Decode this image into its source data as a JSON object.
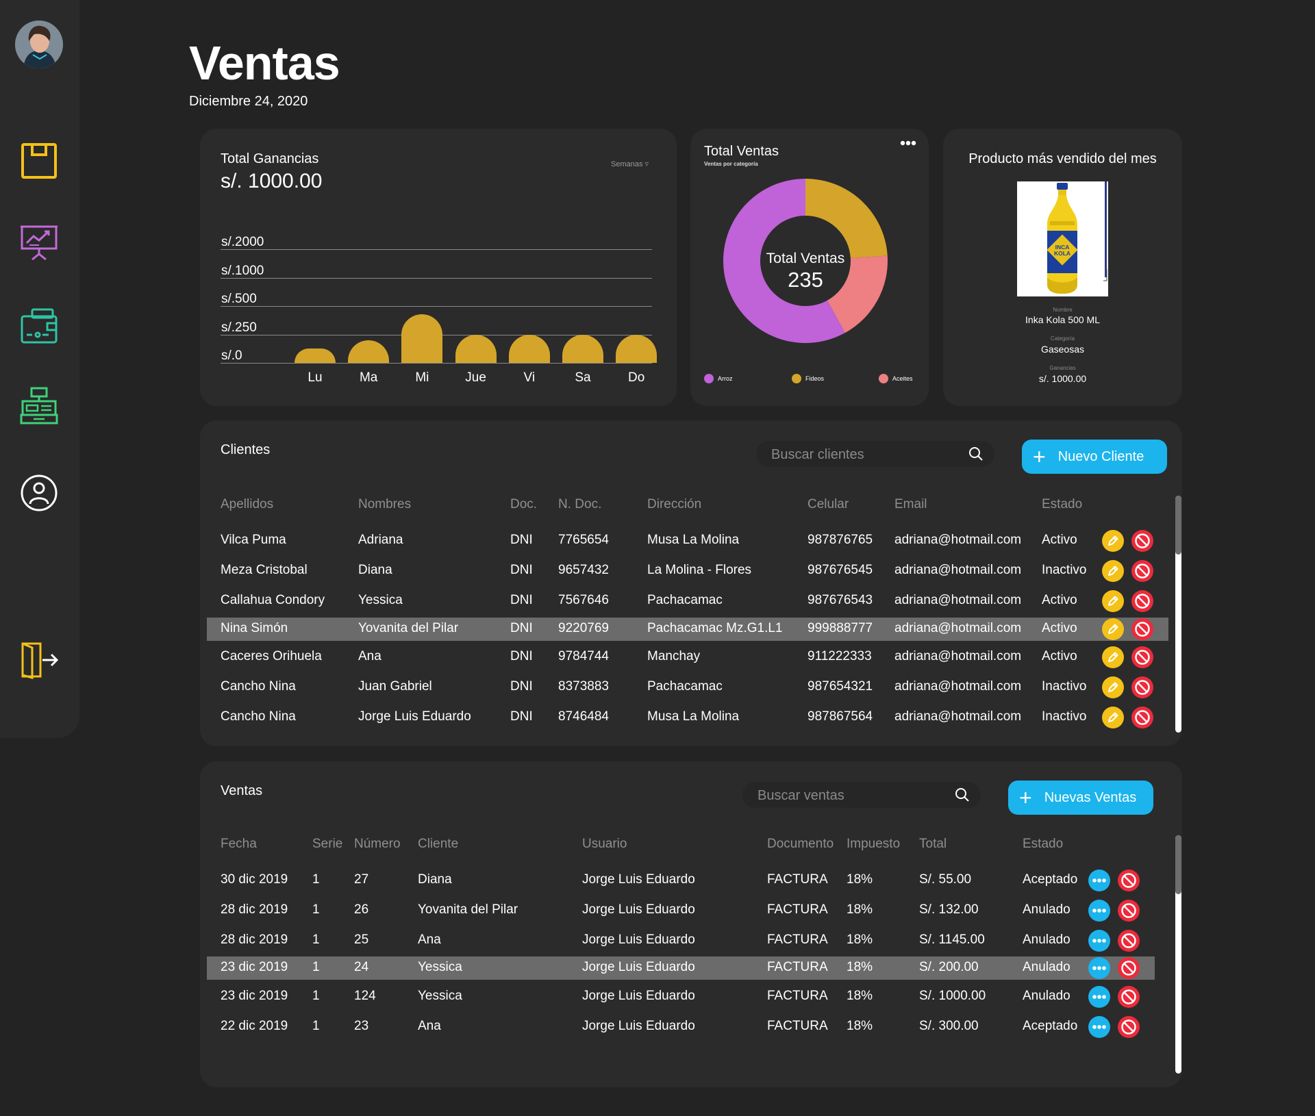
{
  "page": {
    "title": "Ventas",
    "date": "Diciembre 24, 2020"
  },
  "colors": {
    "background": "#232323",
    "card": "#2b2b2b",
    "gold": "#d4a52a",
    "purple": "#c062d8",
    "pink": "#ee7f82",
    "blue": "#1bb4ec",
    "red": "#ec2b3c",
    "yellow": "#f4c119",
    "teal": "#2ec4a6",
    "green": "#3fd27a"
  },
  "sidebar": {
    "icons": [
      "floppy-icon",
      "presentation-chart-icon",
      "wallet-icon",
      "cash-register-icon",
      "user-circle-icon",
      "logout-door-icon"
    ]
  },
  "ganancias": {
    "title": "Total Ganancias",
    "amount": "s/. 1000.00",
    "filter": "Semanas ▿"
  },
  "chart_data": [
    {
      "type": "bar",
      "title": "Total Ganancias",
      "categories": [
        "Lu",
        "Ma",
        "Mi",
        "Jue",
        "Vi",
        "Sa",
        "Do"
      ],
      "values": [
        0.5,
        0.8,
        1.7,
        1.0,
        1.0,
        1.0,
        1.0
      ],
      "ytick_labels": [
        "s/.2000",
        "s/.1000",
        "s/.500",
        "s/.250",
        "s/.0"
      ],
      "ylim": [
        0,
        4
      ],
      "grid": true
    },
    {
      "type": "pie",
      "title": "Total Ventas",
      "subtitle": "Ventas por categoría",
      "center_label": "Total Ventas",
      "center_value": "235",
      "slices": [
        {
          "name": "Arroz",
          "value": 58,
          "color": "#c062d8"
        },
        {
          "name": "Fideos",
          "value": 24,
          "color": "#d4a52a"
        },
        {
          "name": "Aceites",
          "value": 18,
          "color": "#ee7f82"
        }
      ],
      "legend": "bottom"
    }
  ],
  "ventas_card": {
    "menu_icon": "more-horizontal-icon"
  },
  "producto": {
    "title": "Producto más vendido del mes",
    "nombre_label": "Nombre",
    "nombre": "Inka Kola 500 ML",
    "categoria_label": "Categoría",
    "categoria": "Gaseosas",
    "ganancias_label": "Ganancias",
    "ganancias": "s/. 1000.00",
    "bottle_logo": "INCA KOLA"
  },
  "clientes": {
    "title": "Clientes",
    "search_placeholder": "Buscar clientes",
    "new_button": "Nuevo Cliente",
    "columns": [
      "Apellidos",
      "Nombres",
      "Doc.",
      "N. Doc.",
      "Dirección",
      "Celular",
      "Email",
      "Estado"
    ],
    "rows": [
      {
        "apellidos": "Vilca Puma",
        "nombres": "Adriana",
        "doc": "DNI",
        "ndoc": "7765654",
        "direccion": "Musa La Molina",
        "celular": "987876765",
        "email": "adriana@hotmail.com",
        "estado": "Activo"
      },
      {
        "apellidos": "Meza Cristobal",
        "nombres": "Diana",
        "doc": "DNI",
        "ndoc": "9657432",
        "direccion": "La Molina - Flores",
        "celular": "987676545",
        "email": "adriana@hotmail.com",
        "estado": "Inactivo"
      },
      {
        "apellidos": "Callahua Condory",
        "nombres": "Yessica",
        "doc": "DNI",
        "ndoc": "7567646",
        "direccion": "Pachacamac",
        "celular": "987676543",
        "email": "adriana@hotmail.com",
        "estado": "Activo"
      },
      {
        "apellidos": "Nina Simón",
        "nombres": "Yovanita del Pilar",
        "doc": "DNI",
        "ndoc": "9220769",
        "direccion": "Pachacamac Mz.G1.L1",
        "celular": "999888777",
        "email": "adriana@hotmail.com",
        "estado": "Activo"
      },
      {
        "apellidos": "Caceres Orihuela",
        "nombres": "Ana",
        "doc": "DNI",
        "ndoc": "9784744",
        "direccion": "Manchay",
        "celular": "911222333",
        "email": "adriana@hotmail.com",
        "estado": "Activo"
      },
      {
        "apellidos": "Cancho Nina",
        "nombres": "Juan Gabriel",
        "doc": "DNI",
        "ndoc": "8373883",
        "direccion": "Pachacamac",
        "celular": "987654321",
        "email": "adriana@hotmail.com",
        "estado": "Inactivo"
      },
      {
        "apellidos": "Cancho Nina",
        "nombres": "Jorge Luis Eduardo",
        "doc": "DNI",
        "ndoc": "8746484",
        "direccion": "Musa La Molina",
        "celular": "987867564",
        "email": "adriana@hotmail.com",
        "estado": "Inactivo"
      }
    ],
    "selected_index": 3,
    "row_actions": [
      "edit-pencil-icon",
      "block-icon"
    ]
  },
  "ventas": {
    "title": "Ventas",
    "search_placeholder": "Buscar ventas",
    "new_button": "Nuevas Ventas",
    "columns": [
      "Fecha",
      "Serie",
      "Número",
      "Cliente",
      "Usuario",
      "Documento",
      "Impuesto",
      "Total",
      "Estado"
    ],
    "rows": [
      {
        "fecha": "30 dic 2019",
        "serie": "1",
        "numero": "27",
        "cliente": "Diana",
        "usuario": "Jorge Luis Eduardo",
        "documento": "FACTURA",
        "impuesto": "18%",
        "total": "S/. 55.00",
        "estado": "Aceptado"
      },
      {
        "fecha": "28 dic 2019",
        "serie": "1",
        "numero": "26",
        "cliente": "Yovanita del Pilar",
        "usuario": "Jorge Luis Eduardo",
        "documento": "FACTURA",
        "impuesto": "18%",
        "total": "S/. 132.00",
        "estado": "Anulado"
      },
      {
        "fecha": "28 dic 2019",
        "serie": "1",
        "numero": "25",
        "cliente": "Ana",
        "usuario": "Jorge Luis Eduardo",
        "documento": "FACTURA",
        "impuesto": "18%",
        "total": "S/. 1145.00",
        "estado": "Anulado"
      },
      {
        "fecha": "23 dic 2019",
        "serie": "1",
        "numero": "24",
        "cliente": "Yessica",
        "usuario": "Jorge Luis Eduardo",
        "documento": "FACTURA",
        "impuesto": "18%",
        "total": "S/. 200.00",
        "estado": "Anulado"
      },
      {
        "fecha": "23 dic 2019",
        "serie": "1",
        "numero": "124",
        "cliente": "Yessica",
        "usuario": "Jorge Luis Eduardo",
        "documento": "FACTURA",
        "impuesto": "18%",
        "total": "S/. 1000.00",
        "estado": "Anulado"
      },
      {
        "fecha": "22 dic 2019",
        "serie": "1",
        "numero": "23",
        "cliente": "Ana",
        "usuario": "Jorge Luis Eduardo",
        "documento": "FACTURA",
        "impuesto": "18%",
        "total": "S/. 300.00",
        "estado": "Aceptado"
      }
    ],
    "selected_index": 3,
    "row_actions": [
      "more-horizontal-icon",
      "block-icon"
    ]
  }
}
